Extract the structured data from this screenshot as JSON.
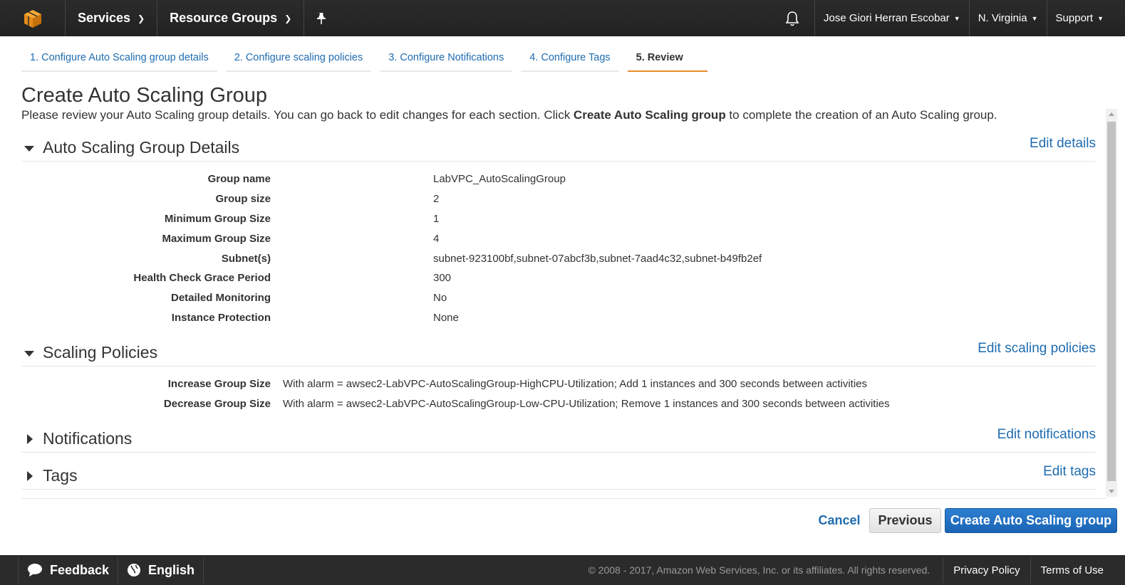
{
  "nav": {
    "services_label": "Services",
    "resource_groups_label": "Resource Groups",
    "user_label": "Jose Giori Herran Escobar",
    "region_label": "N. Virginia",
    "support_label": "Support"
  },
  "steps": [
    {
      "label": "1. Configure Auto Scaling group details",
      "active": false
    },
    {
      "label": "2. Configure scaling policies",
      "active": false
    },
    {
      "label": "3. Configure Notifications",
      "active": false
    },
    {
      "label": "4. Configure Tags",
      "active": false
    },
    {
      "label": "5. Review",
      "active": true
    }
  ],
  "page": {
    "title": "Create Auto Scaling Group",
    "intro_before": "Please review your Auto Scaling group details. You can go back to edit changes for each section. Click ",
    "intro_bold": "Create Auto Scaling group",
    "intro_after": " to complete the creation of an Auto Scaling group."
  },
  "details": {
    "title": "Auto Scaling Group Details",
    "edit_label": "Edit details",
    "rows": [
      {
        "key": "Group name",
        "value": "LabVPC_AutoScalingGroup"
      },
      {
        "key": "Group size",
        "value": "2"
      },
      {
        "key": "Minimum Group Size",
        "value": "1"
      },
      {
        "key": "Maximum Group Size",
        "value": "4"
      },
      {
        "key": "Subnet(s)",
        "value": "subnet-923100bf,subnet-07abcf3b,subnet-7aad4c32,subnet-b49fb2ef"
      },
      {
        "key": "Health Check Grace Period",
        "value": "300"
      },
      {
        "key": "Detailed Monitoring",
        "value": "No"
      },
      {
        "key": "Instance Protection",
        "value": "None"
      }
    ]
  },
  "policies": {
    "title": "Scaling Policies",
    "edit_label": "Edit scaling policies",
    "rows": [
      {
        "key": "Increase Group Size",
        "value": "With alarm = awsec2-LabVPC-AutoScalingGroup-HighCPU-Utilization; Add 1 instances and 300 seconds between activities"
      },
      {
        "key": "Decrease Group Size",
        "value": "With alarm = awsec2-LabVPC-AutoScalingGroup-Low-CPU-Utilization; Remove 1 instances and 300 seconds between activities"
      }
    ]
  },
  "notifications": {
    "title": "Notifications",
    "edit_label": "Edit notifications"
  },
  "tags": {
    "title": "Tags",
    "edit_label": "Edit tags"
  },
  "buttons": {
    "cancel": "Cancel",
    "previous": "Previous",
    "create": "Create Auto Scaling group"
  },
  "footer": {
    "feedback": "Feedback",
    "language": "English",
    "copyright": "© 2008 - 2017, Amazon Web Services, Inc. or its affiliates. All rights reserved.",
    "privacy": "Privacy Policy",
    "terms": "Terms of Use"
  },
  "colors": {
    "link": "#1f6cb0",
    "active_step": "#e68c2c",
    "primary_button": "#1a64b4",
    "nav_bg": "#222222"
  },
  "icons": [
    "aws-cube-icon",
    "pin-icon",
    "bell-icon",
    "speech-bubble-icon",
    "globe-icon"
  ]
}
